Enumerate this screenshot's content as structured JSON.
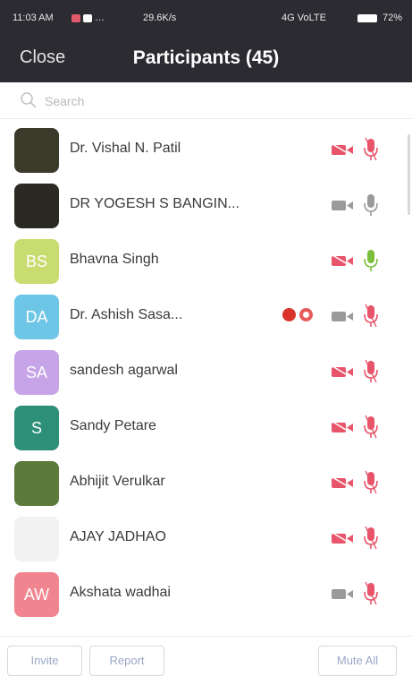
{
  "status_bar": {
    "time": "11:03 AM",
    "speed": "29.6K/s",
    "network": "4G VoLTE",
    "battery": "72%"
  },
  "header": {
    "close_label": "Close",
    "title": "Participants (45)"
  },
  "search": {
    "placeholder": "Search"
  },
  "participants": [
    {
      "name": "Dr. Vishal N. Patil",
      "avatar_initials": "",
      "avatar_color": "#3c3a2a",
      "camera": "off",
      "mic": "muted"
    },
    {
      "name": "DR YOGESH S BANGIN...",
      "avatar_initials": "",
      "avatar_color": "#2b2a22",
      "camera": "on",
      "mic": "unmuted"
    },
    {
      "name": "Bhavna Singh",
      "avatar_initials": "BS",
      "avatar_color": "#c9dc6f",
      "camera": "off",
      "mic": "speaking"
    },
    {
      "name": "Dr. Ashish Sasa...",
      "avatar_initials": "DA",
      "avatar_color": "#6ec6e6",
      "camera": "on",
      "mic": "muted"
    },
    {
      "name": "sandesh agarwal",
      "avatar_initials": "SA",
      "avatar_color": "#c7a4e8",
      "camera": "off",
      "mic": "muted"
    },
    {
      "name": "Sandy Petare",
      "avatar_initials": "S",
      "avatar_color": "#2e8f78",
      "camera": "off",
      "mic": "muted"
    },
    {
      "name": "Abhijit Verulkar",
      "avatar_initials": "",
      "avatar_color": "#5c7a3a",
      "camera": "off",
      "mic": "muted"
    },
    {
      "name": "AJAY JADHAO",
      "avatar_initials": "",
      "avatar_color": "#f2f2f2",
      "camera": "off",
      "mic": "muted"
    },
    {
      "name": "Akshata wadhai",
      "avatar_initials": "AW",
      "avatar_color": "#f0858f",
      "camera": "on",
      "mic": "muted"
    }
  ],
  "footer": {
    "invite_label": "Invite",
    "report_label": "Report",
    "mute_all_label": "Mute All"
  },
  "colors": {
    "header_bg": "#2c2b31",
    "muted_red": "#e8546a",
    "speaking_green": "#7bbf3a",
    "neutral_gray": "#9a9a9a",
    "raise_hand_red": "#d9332b"
  }
}
